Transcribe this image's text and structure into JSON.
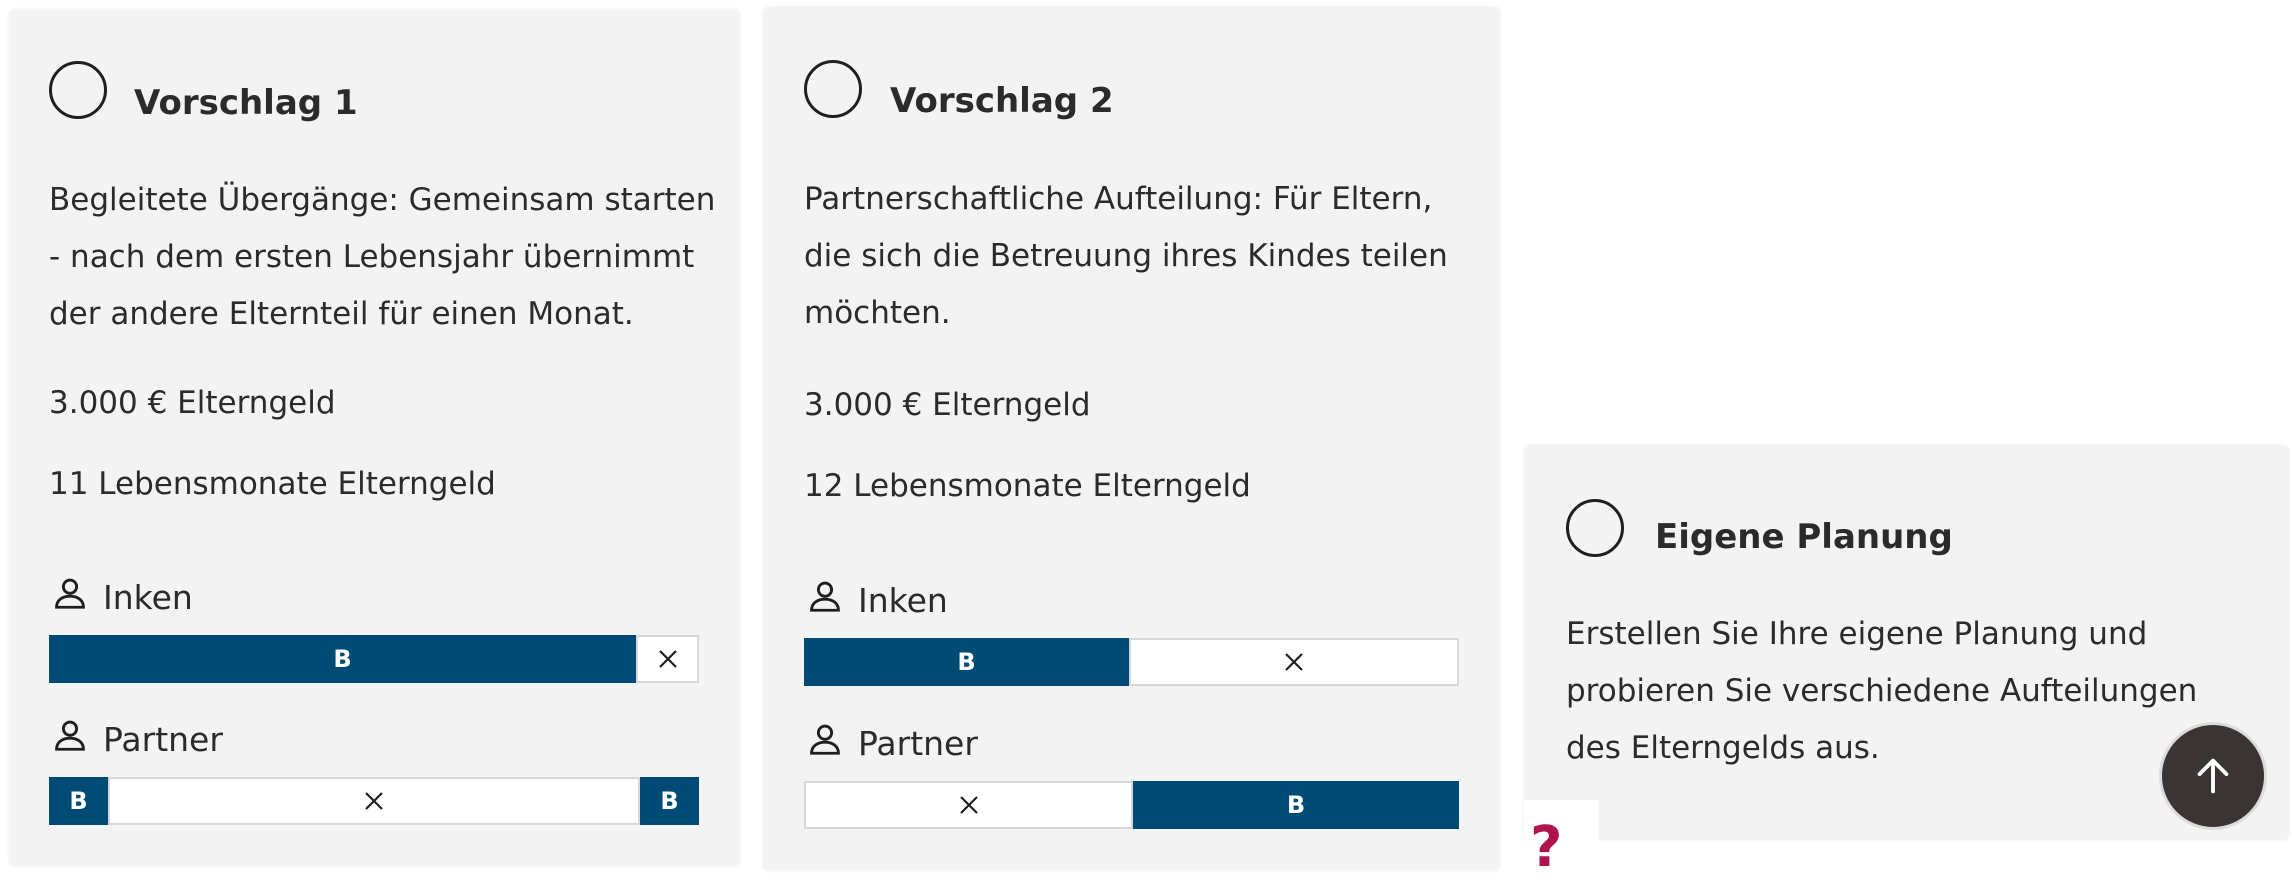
{
  "cards": [
    {
      "title": "Vorschlag 1",
      "description_lines": [
        "Begleitete Übergänge: Gemeinsam starten",
        "- nach dem ersten Lebensjahr übernimmt",
        "der andere Elternteil für einen Monat."
      ],
      "amount": "3.000 € Elterngeld",
      "months": "11 Lebensmonate Elterngeld",
      "parents": [
        {
          "name": "Inken",
          "segments": [
            "B",
            "×"
          ]
        },
        {
          "name": "Partner",
          "segments": [
            "B",
            "×",
            "B"
          ]
        }
      ]
    },
    {
      "title": "Vorschlag 2",
      "description_lines": [
        "Partnerschaftliche Aufteilung: Für Eltern,",
        "die sich die Betreuung ihres Kindes teilen",
        "möchten."
      ],
      "amount": "3.000 € Elterngeld",
      "months": "12 Lebensmonate Elterngeld",
      "parents": [
        {
          "name": "Inken",
          "segments": [
            "B",
            "×"
          ]
        },
        {
          "name": "Partner",
          "segments": [
            "×",
            "B"
          ]
        }
      ]
    },
    {
      "title": "Eigene Planung",
      "description_lines": [
        "Erstellen Sie Ihre eigene Planung und",
        "probieren Sie verschiedene Aufteilungen",
        "des Elterngelds aus."
      ]
    }
  ],
  "help": {
    "label": "?"
  },
  "colors": {
    "bar_fill": "#004b76",
    "card_bg": "#f3f3f3",
    "help_accent": "#b0144f",
    "scroll_button_bg": "#3a3434"
  },
  "icons": {
    "person": "person-outline-icon",
    "empty": "close-x-icon",
    "scroll_top": "arrow-up-icon"
  }
}
